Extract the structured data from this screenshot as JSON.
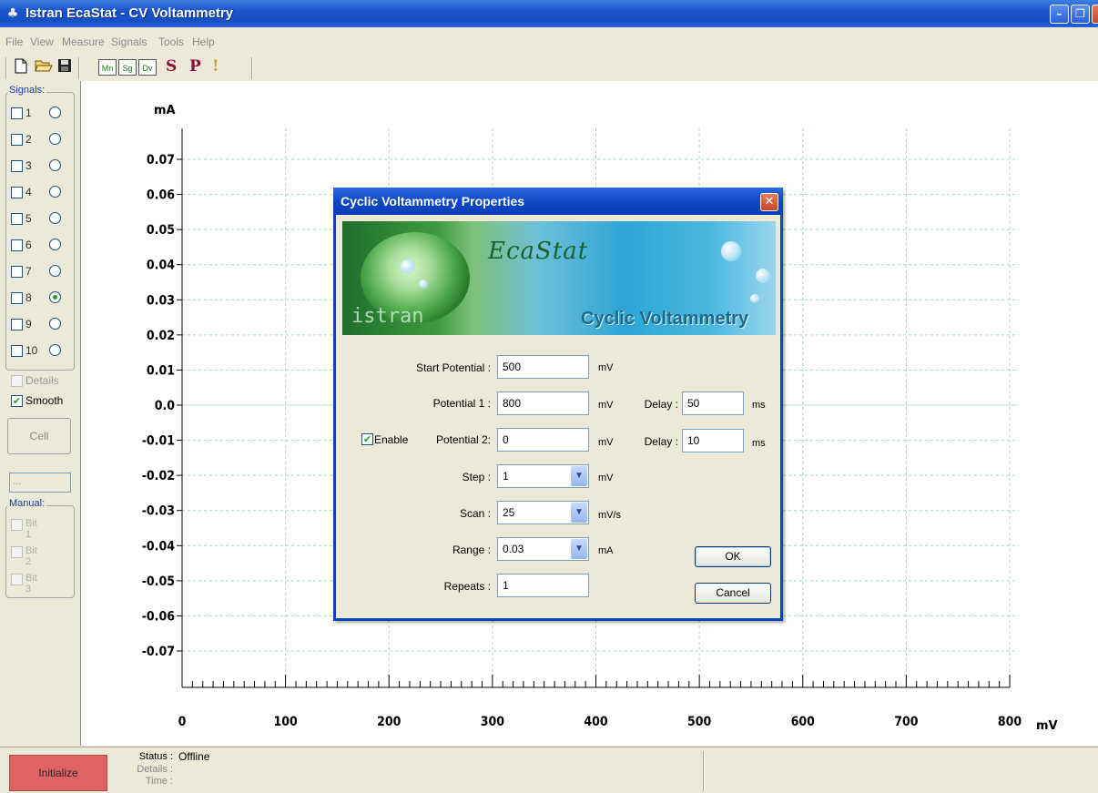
{
  "window": {
    "title": "Istran EcaStat - CV Voltammetry",
    "min_label": "–",
    "max_label": "❐",
    "close_label": "✕"
  },
  "menu": [
    "File",
    "View",
    "Measure",
    "Signals",
    "Tools",
    "Help"
  ],
  "toolbar": {
    "new_icon": "new-file-icon",
    "open_icon": "open-folder-icon",
    "save_icon": "floppy-save-icon",
    "mn": "Mn",
    "sg": "Sg",
    "dv": "Dv",
    "s": "S",
    "p": "P",
    "exclaim": "!"
  },
  "sidebar": {
    "signals_label": "Signals:",
    "signals": [
      {
        "num": "1",
        "checked": false,
        "selected": false
      },
      {
        "num": "2",
        "checked": false,
        "selected": false
      },
      {
        "num": "3",
        "checked": false,
        "selected": false
      },
      {
        "num": "4",
        "checked": false,
        "selected": false
      },
      {
        "num": "5",
        "checked": false,
        "selected": false
      },
      {
        "num": "6",
        "checked": false,
        "selected": false
      },
      {
        "num": "7",
        "checked": false,
        "selected": false
      },
      {
        "num": "8",
        "checked": false,
        "selected": true
      },
      {
        "num": "9",
        "checked": false,
        "selected": false
      },
      {
        "num": "10",
        "checked": false,
        "selected": false
      }
    ],
    "details_label": "Details",
    "smooth_label": "Smooth",
    "smooth_checked": true,
    "cell_label": "Cell",
    "cell_field": "...",
    "manual_label": "Manual:",
    "bits": [
      "Bit 1",
      "Bit 2",
      "Bit 3"
    ]
  },
  "chart_data": {
    "type": "line",
    "title": "",
    "xlabel": "mV",
    "ylabel": "mA",
    "xlim": [
      0,
      800
    ],
    "ylim": [
      -0.07,
      0.07
    ],
    "x_ticks": [
      "0",
      "100",
      "200",
      "300",
      "400",
      "500",
      "600",
      "700",
      "800"
    ],
    "y_ticks": [
      "0.07",
      "0.06",
      "0.05",
      "0.04",
      "0.03",
      "0.02",
      "0.01",
      "0.0",
      "-0.01",
      "-0.02",
      "-0.03",
      "-0.04",
      "-0.05",
      "-0.06",
      "-0.07"
    ],
    "grid": true,
    "series": []
  },
  "status": {
    "initialize_label": "Initialize",
    "status_label": "Status :",
    "status_value": "Offline",
    "details_label": "Details :",
    "time_label": "Time :"
  },
  "dialog": {
    "title": "Cyclic Voltammetry Properties",
    "banner_brand": "EcaStat",
    "banner_company": "istran",
    "banner_caption": "Cyclic Voltammetry",
    "start_potential_label": "Start Potential :",
    "start_potential": "500",
    "potential1_label": "Potential 1 :",
    "potential1": "800",
    "delay1_label": "Delay :",
    "delay1": "50",
    "enable_label": "Enable",
    "enable_checked": true,
    "potential2_label": "Potential 2:",
    "potential2": "0",
    "delay2_label": "Delay :",
    "delay2": "10",
    "step_label": "Step :",
    "step": "1",
    "scan_label": "Scan :",
    "scan": "25",
    "range_label": "Range :",
    "range": "0.03",
    "repeats_label": "Repeats :",
    "repeats": "1",
    "unit_mv": "mV",
    "unit_ms": "ms",
    "unit_mvs": "mV/s",
    "unit_ma": "mA",
    "ok_label": "OK",
    "cancel_label": "Cancel"
  }
}
